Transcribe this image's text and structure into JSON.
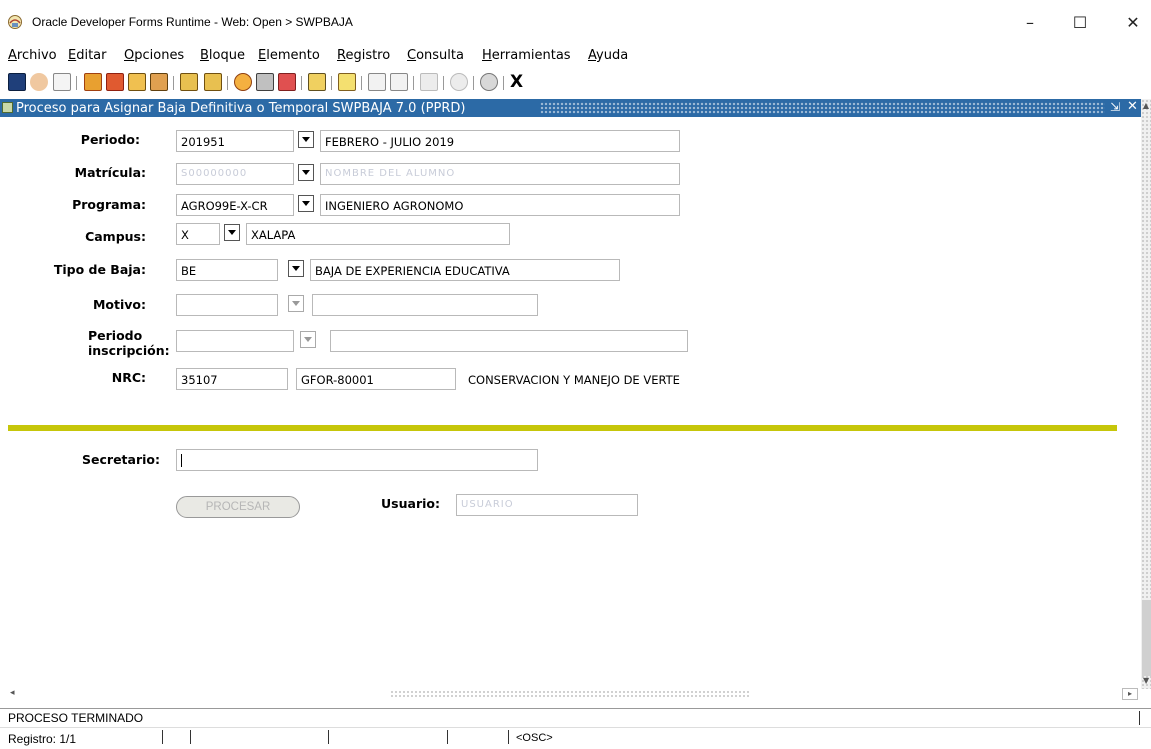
{
  "window": {
    "title": "Oracle Developer Forms Runtime - Web: Open > SWPBAJA",
    "minimize": "–",
    "maximize": "☐",
    "close": "✕"
  },
  "menu": [
    {
      "accel": "A",
      "rest": "rchivo"
    },
    {
      "accel": "E",
      "rest": "ditar"
    },
    {
      "accel": "O",
      "rest": "pciones"
    },
    {
      "accel": "B",
      "rest": "loque"
    },
    {
      "accel": "E",
      "rest": "lemento"
    },
    {
      "accel": "R",
      "rest": "egistro"
    },
    {
      "accel": "C",
      "rest": "onsulta"
    },
    {
      "accel": "H",
      "rest": "erramientas"
    },
    {
      "accel": "A",
      "rest": "yuda"
    }
  ],
  "toolbar": {
    "exit_label": "X",
    "icons": [
      "save-icon",
      "undo-icon",
      "print-preview-icon",
      "enter-query-icon",
      "execute-query-icon",
      "previous-block-icon",
      "next-block-icon",
      "previous-record-icon",
      "next-record-icon",
      "insert-record-icon",
      "remove-record-icon",
      "lock-record-icon",
      "edit-icon",
      "print-icon",
      "keys-icon",
      "display-error-icon",
      "volume-icon",
      "link-icon",
      "help-icon"
    ]
  },
  "form": {
    "header": "Proceso para Asignar Baja Definitiva o Temporal  SWPBAJA  7.0  (PPRD)",
    "header_controls": {
      "minimize": "⇲",
      "close": "✕"
    },
    "periodo": {
      "label": "Periodo:",
      "code": "201951",
      "desc": "FEBRERO - JULIO 2019"
    },
    "matricula": {
      "label": "Matrícula:",
      "code": "S00000000",
      "desc": "NOMBRE DEL ALUMNO"
    },
    "programa": {
      "label": "Programa:",
      "code": "AGRO99E-X-CR",
      "desc": "INGENIERO AGRONOMO"
    },
    "campus": {
      "label": "Campus:",
      "code": "X",
      "desc": "XALAPA"
    },
    "tipo_baja": {
      "label": "Tipo de Baja:",
      "code": "BE",
      "desc": "BAJA DE EXPERIENCIA EDUCATIVA"
    },
    "motivo": {
      "label": "Motivo:",
      "code": "",
      "desc": ""
    },
    "periodo_inscripcion": {
      "label_line1": "Periodo",
      "label_line2": "inscripción:",
      "code": "",
      "desc": ""
    },
    "nrc": {
      "label": "NRC:",
      "code": "35107",
      "course": "GFOR-80001",
      "title": "CONSERVACION Y MANEJO DE VERTE"
    },
    "secretario": {
      "label": "Secretario:",
      "value": ""
    },
    "procesar_label": "PROCESAR",
    "usuario": {
      "label": "Usuario:",
      "value": "USUARIO"
    }
  },
  "status": {
    "message": "PROCESO TERMINADO",
    "record": "Registro: 1/1",
    "osc": "<OSC>"
  }
}
